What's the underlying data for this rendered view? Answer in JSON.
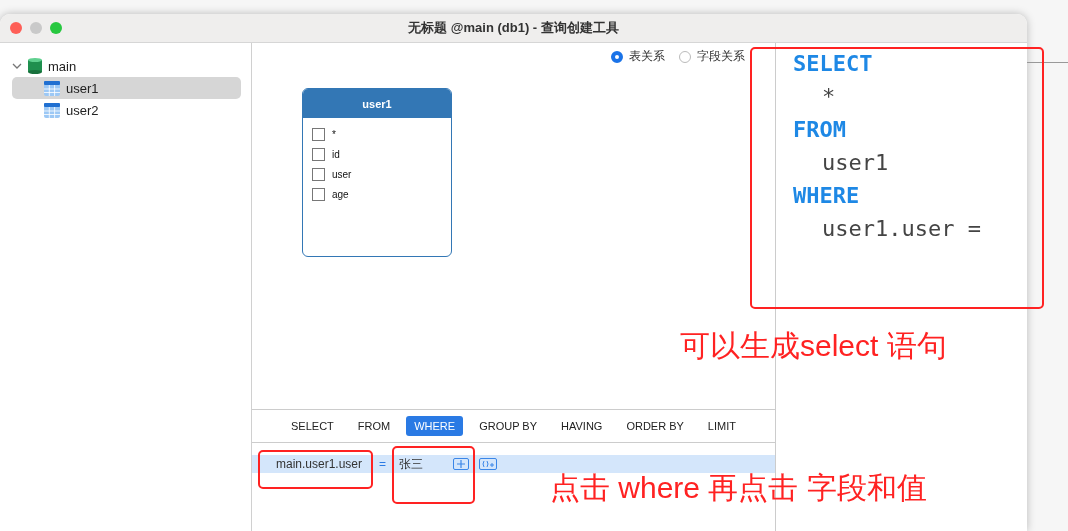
{
  "window": {
    "title": "无标题 @main (db1) - 查询创建工具"
  },
  "sidebar": {
    "items": [
      {
        "label": "main",
        "expanded": true,
        "selected": false,
        "children": [
          {
            "label": "user1",
            "selected": true
          },
          {
            "label": "user2",
            "selected": false
          }
        ]
      }
    ]
  },
  "view_modes": [
    {
      "label": "表关系",
      "selected": true
    },
    {
      "label": "字段关系",
      "selected": false
    }
  ],
  "table_card": {
    "title": "user1",
    "fields": [
      {
        "label": "*",
        "checked": false
      },
      {
        "label": "id",
        "checked": false
      },
      {
        "label": "user",
        "checked": false
      },
      {
        "label": "age",
        "checked": false
      }
    ]
  },
  "clause_tabs": [
    {
      "label": "SELECT",
      "selected": false
    },
    {
      "label": "FROM",
      "selected": false
    },
    {
      "label": "WHERE",
      "selected": true
    },
    {
      "label": "GROUP BY",
      "selected": false
    },
    {
      "label": "HAVING",
      "selected": false
    },
    {
      "label": "ORDER BY",
      "selected": false
    },
    {
      "label": "LIMIT",
      "selected": false
    }
  ],
  "conditions": [
    {
      "field": "main.user1.user",
      "operator": "=",
      "value": "张三"
    }
  ],
  "sql": [
    {
      "kind": "keyword",
      "text": "SELECT"
    },
    {
      "kind": "value",
      "text": "*"
    },
    {
      "kind": "keyword",
      "text": "FROM"
    },
    {
      "kind": "value",
      "text": "user1"
    },
    {
      "kind": "keyword",
      "text": "WHERE"
    },
    {
      "kind": "value",
      "text": "user1.user ="
    }
  ],
  "annotations": [
    "可以生成select 语句",
    "点击 where 再点击 字段和值"
  ]
}
